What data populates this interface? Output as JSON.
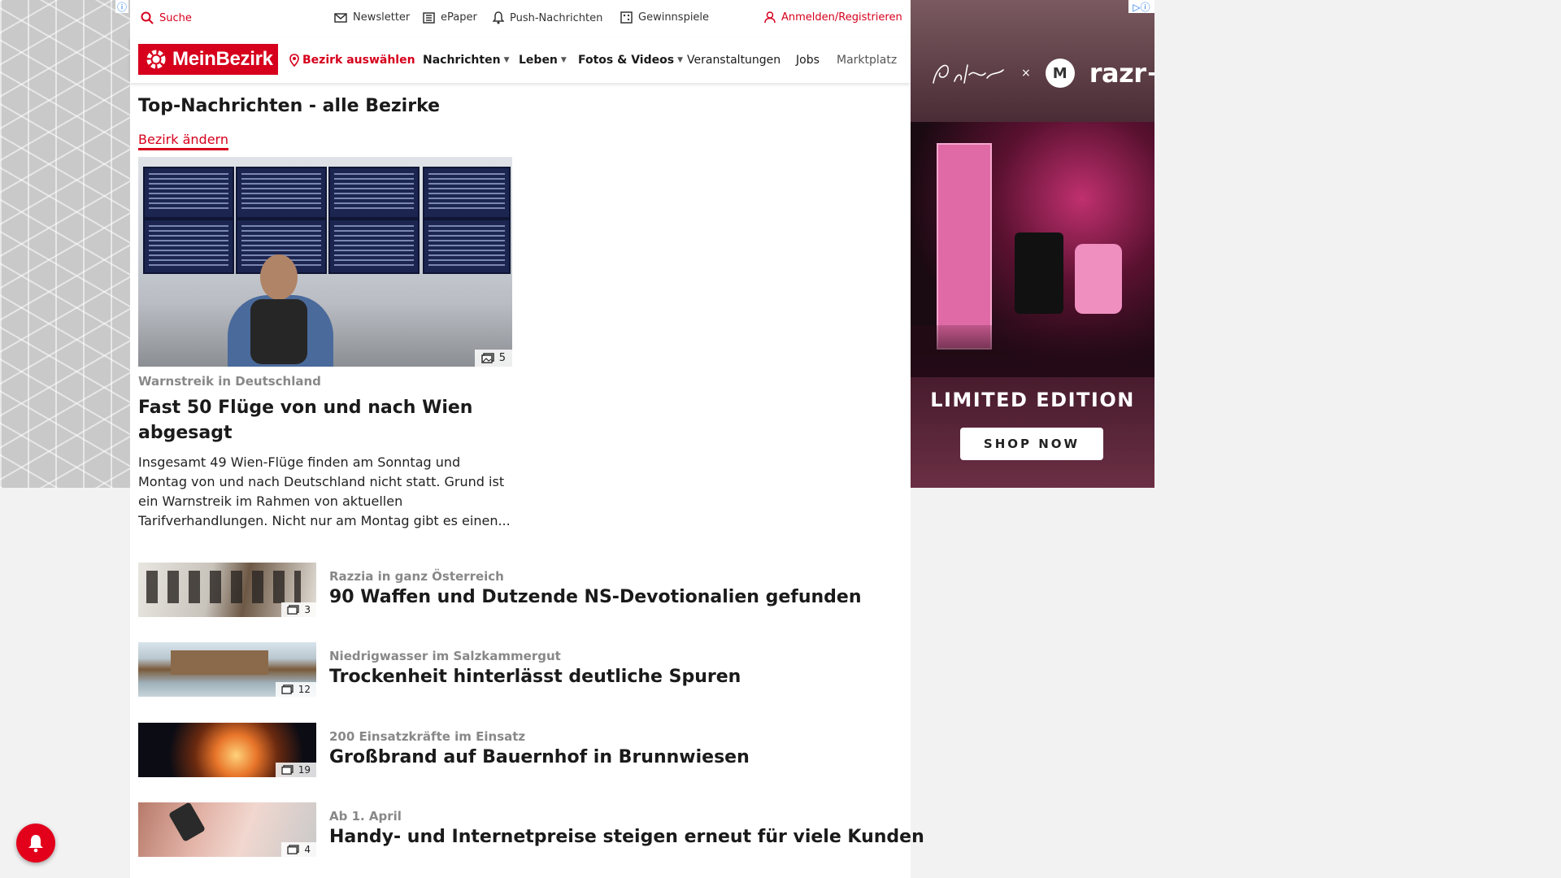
{
  "utility_bar": {
    "search_label": "Suche",
    "newsletter_label": "Newsletter",
    "epaper_label": "ePaper",
    "push_label": "Push-Nachrichten",
    "gewinnspiele_label": "Gewinnspiele",
    "login_label": "Anmelden/Registrieren"
  },
  "nav": {
    "logo_text": "MeinBezirk",
    "district_select": "Bezirk auswählen",
    "items": [
      {
        "label": "Nachrichten",
        "dropdown": true
      },
      {
        "label": "Leben",
        "dropdown": true
      },
      {
        "label": "Fotos & Videos",
        "dropdown": true
      },
      {
        "label": "Veranstaltungen",
        "dropdown": false
      },
      {
        "label": "Jobs",
        "dropdown": false
      },
      {
        "label": "Marktplatz",
        "dropdown": false
      }
    ]
  },
  "main": {
    "heading": "Top-Nachrichten - alle Bezirke",
    "change_district": "Bezirk ändern",
    "hero": {
      "image_count": "5",
      "kicker": "Warnstreik in Deutschland",
      "title": "Fast 50 Flüge von und nach Wien abgesagt",
      "teaser": "Insgesamt 49 Wien-Flüge finden am Sonntag und Montag von und nach Deutschland nicht statt. Grund ist ein Warnstreik im Rahmen von aktuellen Tarifverhandlungen. Nicht nur am Montag gibt es einen..."
    },
    "articles": [
      {
        "kicker": "Razzia in ganz Österreich",
        "title": "90 Waffen und Dutzende NS-Devotionalien gefunden",
        "image_count": "3"
      },
      {
        "kicker": "Niedrigwasser im Salzkammergut",
        "title": "Trockenheit hinterlässt deutliche Spuren",
        "image_count": "12"
      },
      {
        "kicker": "200 Einsatzkräfte im Einsatz",
        "title": "Großbrand auf Bauernhof in Brunnwiesen",
        "image_count": "19"
      },
      {
        "kicker": "Ab 1. April",
        "title": "Handy- und Internetpreise steigen erneut für viele Kunden",
        "image_count": "4"
      }
    ]
  },
  "ad": {
    "cobrand_x": "×",
    "moto_glyph": "M",
    "razr_text": "razr+",
    "headline": "LIMITED EDITION",
    "cta": "SHOP NOW"
  },
  "colors": {
    "brand_red": "#d6001c",
    "kicker_gray": "#888888",
    "page_background": "#f2f2f2"
  },
  "icons": {
    "search": "search-icon",
    "newsletter": "mail-icon",
    "epaper": "newspaper-icon",
    "push": "bell-icon",
    "gewinnspiele": "gift-icon",
    "login": "user-icon",
    "district": "location-pin-icon",
    "gallery": "gallery-icon"
  }
}
